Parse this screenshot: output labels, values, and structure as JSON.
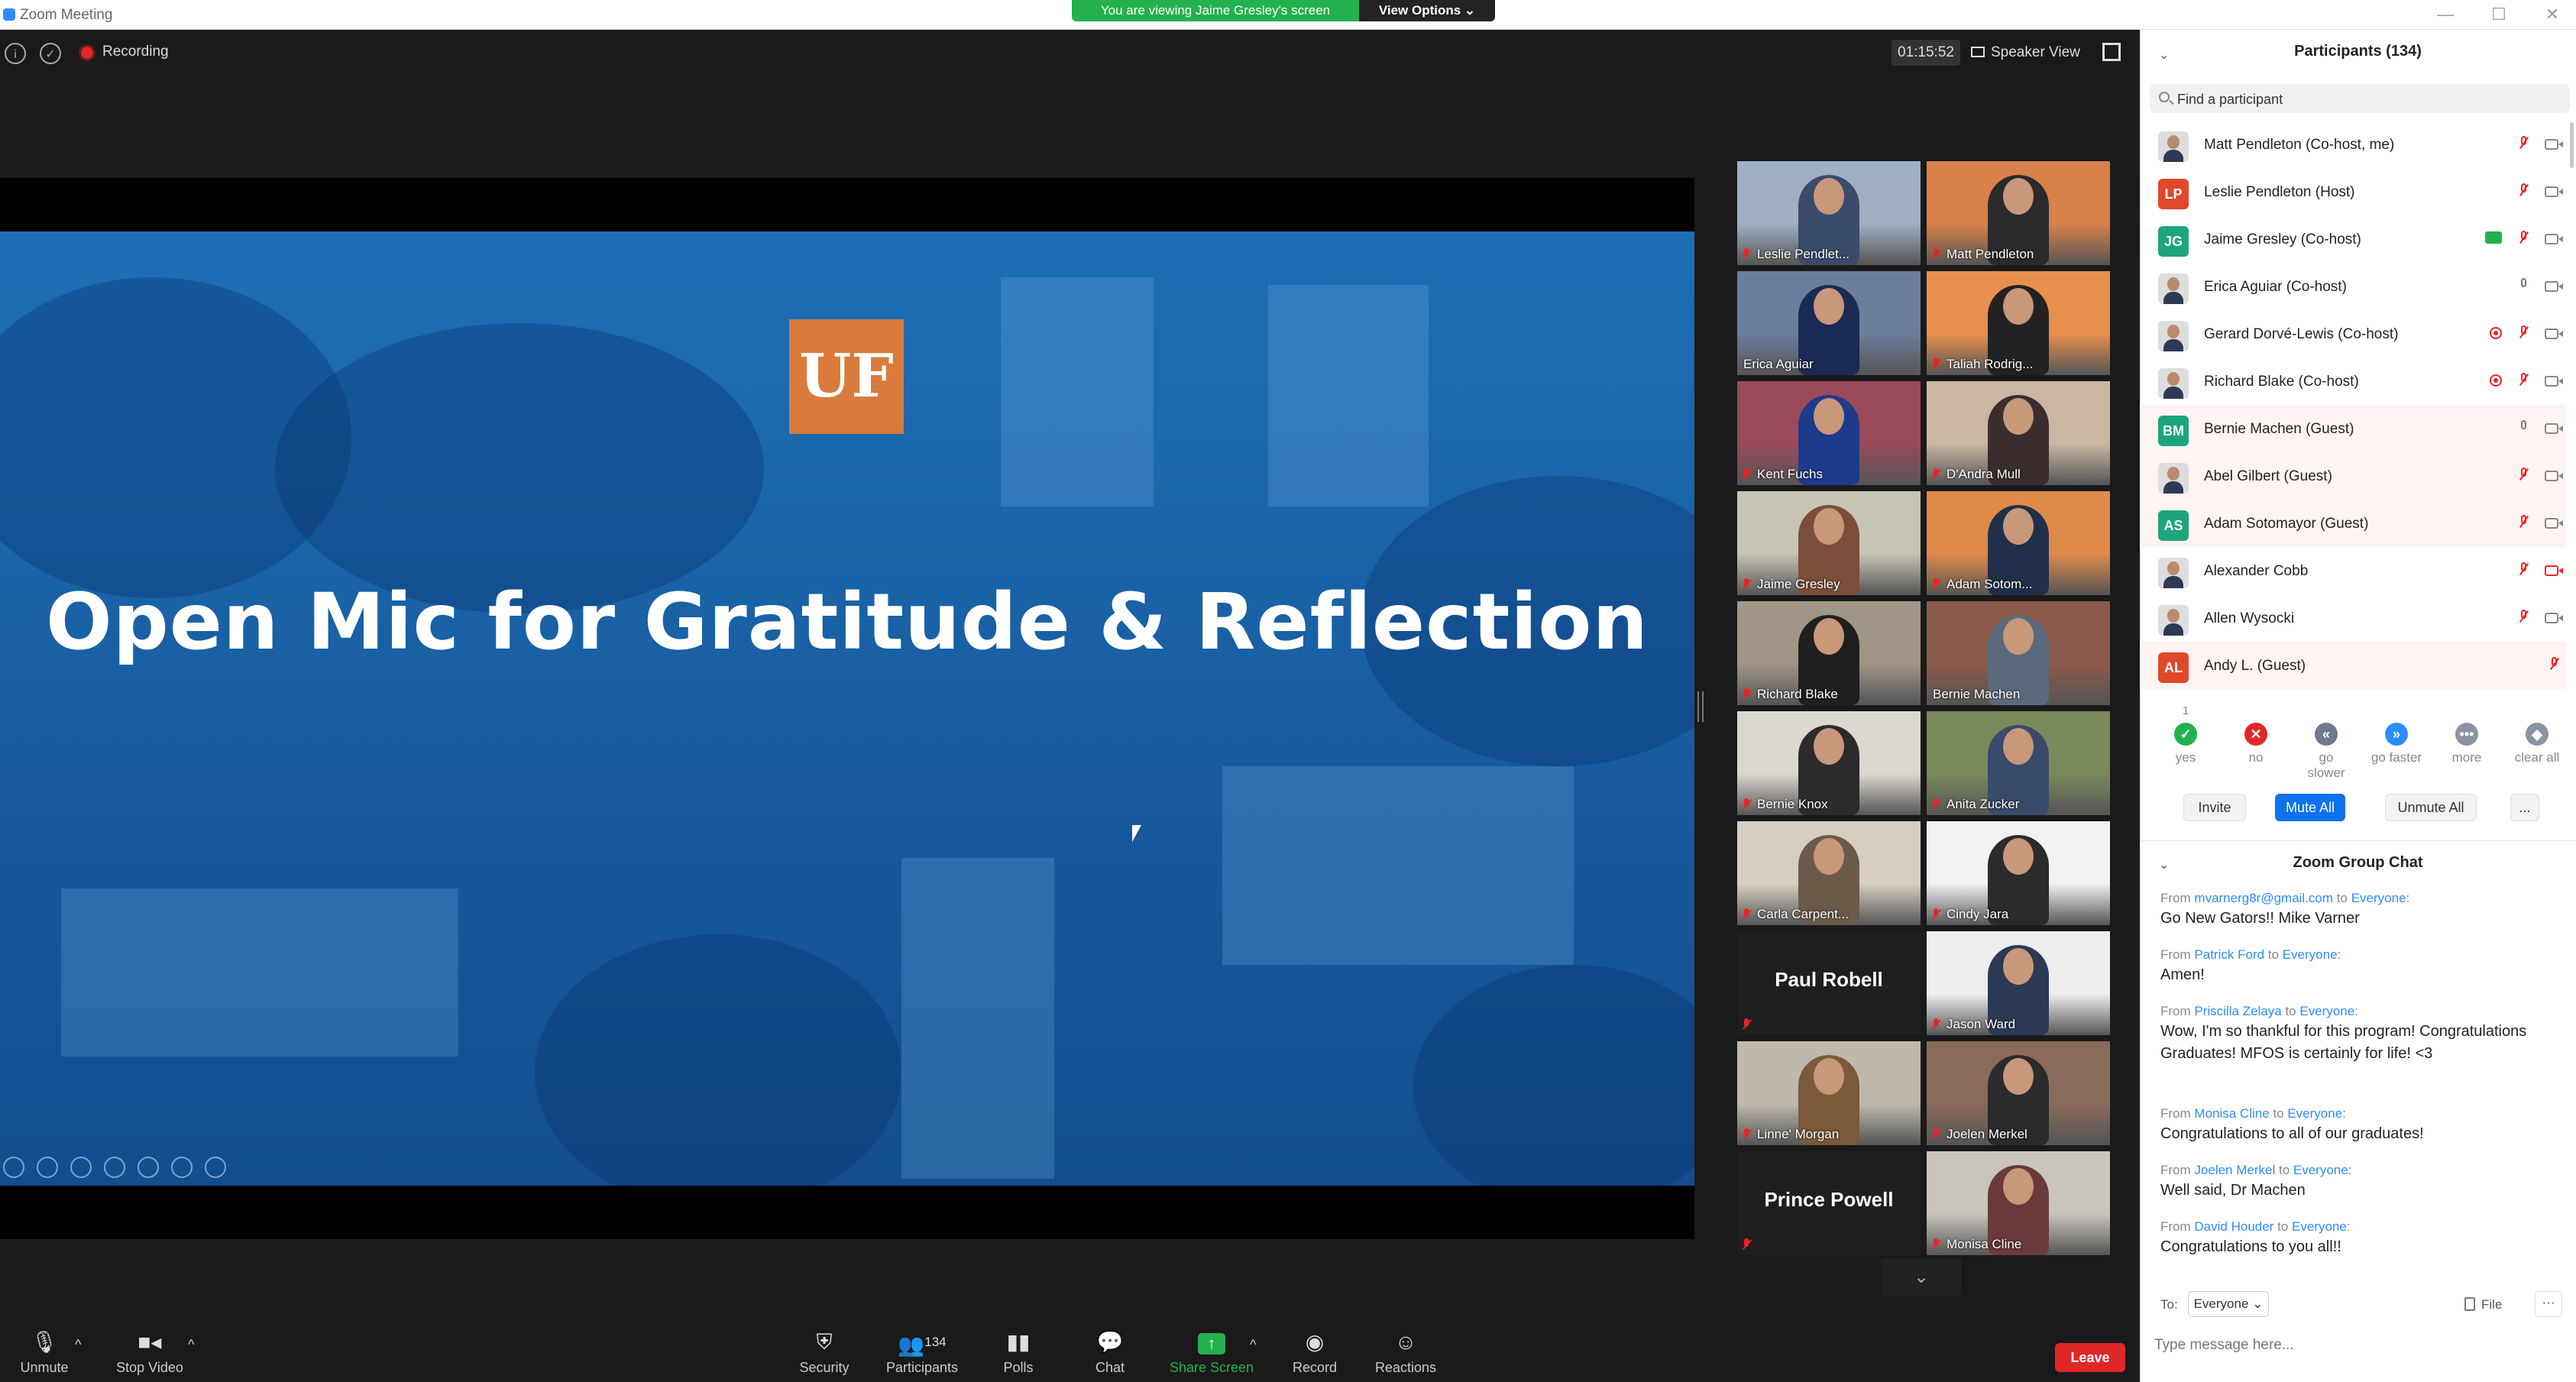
{
  "window": {
    "title": "Zoom Meeting",
    "controls": {
      "minimize": "—",
      "maximize": "☐",
      "close": "✕"
    }
  },
  "banner": {
    "viewing": "You are viewing Jaime Gresley's screen",
    "view_options": "View Options ⌄"
  },
  "topbar": {
    "info_icon": "i",
    "shield_icon": "✓",
    "recording": "Recording",
    "timer": "01:15:52",
    "speaker_view": "Speaker View"
  },
  "slide": {
    "logo": "UF",
    "title": "Open Mic for Gratitude & Reflection"
  },
  "gallery": [
    {
      "name": "Leslie Pendlet...",
      "muted": true,
      "video": true
    },
    {
      "name": "Matt Pendleton",
      "muted": true,
      "video": true
    },
    {
      "name": "Erica Aguiar",
      "muted": false,
      "video": true,
      "active": true
    },
    {
      "name": "Taliah Rodrig...",
      "muted": true,
      "video": true
    },
    {
      "name": "Kent Fuchs",
      "muted": true,
      "video": true
    },
    {
      "name": "D'Andra Mull",
      "muted": true,
      "video": true
    },
    {
      "name": "Jaime Gresley",
      "muted": true,
      "video": true
    },
    {
      "name": "Adam Sotom...",
      "muted": true,
      "video": true
    },
    {
      "name": "Richard Blake",
      "muted": true,
      "video": true
    },
    {
      "name": "Bernie Machen",
      "muted": false,
      "video": true
    },
    {
      "name": "Bernie Knox",
      "muted": true,
      "video": true
    },
    {
      "name": "Anita Zucker",
      "muted": true,
      "video": true
    },
    {
      "name": "Carla Carpent...",
      "muted": true,
      "video": true
    },
    {
      "name": "Cindy Jara",
      "muted": true,
      "video": true
    },
    {
      "name": "Paul Robell",
      "muted": true,
      "video": false
    },
    {
      "name": "Jason Ward",
      "muted": true,
      "video": true
    },
    {
      "name": "Linne' Morgan",
      "muted": true,
      "video": true
    },
    {
      "name": "Joelen Merkel",
      "muted": true,
      "video": true
    },
    {
      "name": "Prince Powell",
      "muted": true,
      "video": false
    },
    {
      "name": "Monisa Cline",
      "muted": true,
      "video": true
    }
  ],
  "toolbar": {
    "unmute": "Unmute",
    "stop_video": "Stop Video",
    "security": "Security",
    "participants": "Participants",
    "participants_count": "134",
    "polls": "Polls",
    "chat": "Chat",
    "share_screen": "Share Screen",
    "record": "Record",
    "reactions": "Reactions",
    "leave": "Leave"
  },
  "participants_panel": {
    "title": "Participants (134)",
    "search_placeholder": "Find a participant",
    "list": [
      {
        "name": "Matt Pendleton (Co-host, me)",
        "avatar": "photo",
        "mic": "off",
        "cam": "on"
      },
      {
        "name": "Leslie Pendleton (Host)",
        "avatar": "LP",
        "color": "#e0472b",
        "mic": "off",
        "cam": "on"
      },
      {
        "name": "Jaime Gresley (Co-host)",
        "avatar": "JG",
        "color": "#1da57e",
        "mic": "off",
        "cam": "on",
        "sharing": true
      },
      {
        "name": "Erica Aguiar (Co-host)",
        "avatar": "photo",
        "mic": "on",
        "cam": "on"
      },
      {
        "name": "Gerard Dorvé-Lewis (Co-host)",
        "avatar": "photo",
        "mic": "off",
        "cam": "on",
        "recording": true
      },
      {
        "name": "Richard Blake (Co-host)",
        "avatar": "photo",
        "mic": "off",
        "cam": "on",
        "recording": true
      },
      {
        "name": "Bernie Machen (Guest)",
        "avatar": "BM",
        "color": "#1da57e",
        "mic": "on",
        "cam": "on",
        "highlight": true
      },
      {
        "name": "Abel Gilbert (Guest)",
        "avatar": "photo",
        "mic": "off",
        "cam": "on",
        "highlight": true
      },
      {
        "name": "Adam Sotomayor (Guest)",
        "avatar": "AS",
        "color": "#1da57e",
        "mic": "off",
        "cam": "on",
        "highlight": true
      },
      {
        "name": "Alexander Cobb",
        "avatar": "photo",
        "mic": "off",
        "cam": "off"
      },
      {
        "name": "Allen Wysocki",
        "avatar": "photo",
        "mic": "off",
        "cam": "on"
      },
      {
        "name": "Andy L. (Guest)",
        "avatar": "AL",
        "color": "#e0472b",
        "mic": "off",
        "cam": "none",
        "highlight": true
      }
    ],
    "reactions": [
      {
        "label": "yes",
        "symbol": "✓",
        "color": "#23b14d",
        "count": "1"
      },
      {
        "label": "no",
        "symbol": "✕",
        "color": "#e02828",
        "count": ""
      },
      {
        "label": "go slower",
        "symbol": "«",
        "color": "#6d7a91",
        "count": ""
      },
      {
        "label": "go faster",
        "symbol": "»",
        "color": "#2d8cff",
        "count": ""
      },
      {
        "label": "more",
        "symbol": "•••",
        "color": "#8a93a3",
        "count": ""
      },
      {
        "label": "clear all",
        "symbol": "◆",
        "color": "#8a93a3",
        "count": ""
      }
    ],
    "invite": "Invite",
    "mute_all": "Mute All",
    "unmute_all": "Unmute All",
    "more": "..."
  },
  "chat": {
    "title": "Zoom Group Chat",
    "messages": [
      {
        "from": "mvarnerg8r@gmail.com",
        "to": "Everyone",
        "text": "Go New Gators!!  Mike Varner"
      },
      {
        "from": "Patrick Ford",
        "to": "Everyone",
        "text": "Amen!"
      },
      {
        "from": "Priscilla Zelaya",
        "to": "Everyone",
        "text": "Wow, I'm so thankful for this program! Congratulations Graduates! MFOS is certainly for life! <3"
      },
      {
        "from": "Monisa Cline",
        "to": "Everyone",
        "text": "Congratulations to all of our graduates!"
      },
      {
        "from": "Joelen Merkel",
        "to": "Everyone",
        "text": "Well said, Dr Machen"
      },
      {
        "from": "David Houder",
        "to": "Everyone",
        "text": "Congratulations to you all!!"
      }
    ],
    "from_word": "From",
    "to_word": "to",
    "to_label": "To:",
    "to_value": "Everyone ⌄",
    "file": "File",
    "more": "···",
    "input_placeholder": "Type message here..."
  }
}
